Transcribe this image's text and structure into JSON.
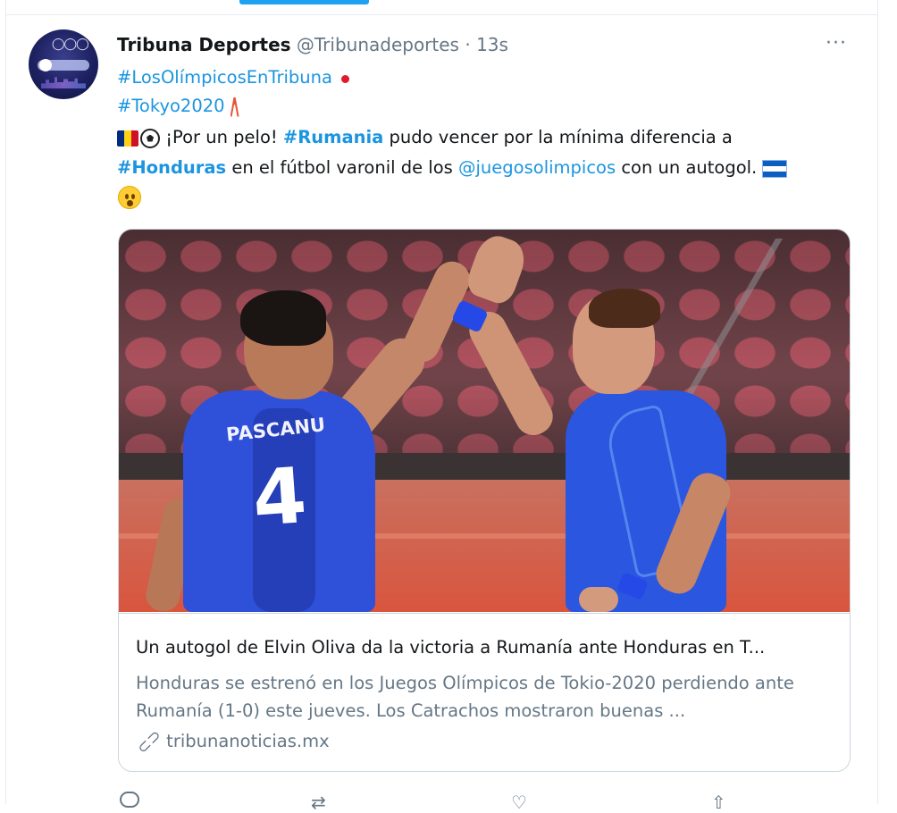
{
  "tweet": {
    "author_name": "Tribuna Deportes",
    "author_handle": "@Tribunadeportes",
    "separator": "·",
    "timestamp": "13s",
    "more_label": "···",
    "hashtag_1": "#LosOlímpicosEnTribuna",
    "hashtag_2": "#Tokyo2020",
    "line3_text_a": "¡Por un pelo! ",
    "hashtag_rumania": "#Rumania",
    "line3_text_b": " pudo vencer por la mínima diferencia a",
    "hashtag_honduras": "#Honduras",
    "line4_text_a": " en el fútbol varonil de los ",
    "mention": "@juegosolimpicos",
    "line4_text_b": " con un autogol."
  },
  "card": {
    "title": "Un autogol de Elvin Oliva da la victoria a Rumanía ante Honduras en T...",
    "description": "Honduras se estrenó en los Juegos Olímpicos de Tokio-2020 perdiendo ante Rumanía (1-0) este jueves. Los Catrachos mostraron buenas ...",
    "domain": "tribunanoticias.mx",
    "image": {
      "player_name": "PASCANU",
      "player_number": "4"
    }
  },
  "icons": {
    "avatar": "olympic-avatar",
    "more": "more-icon",
    "link": "link-icon",
    "reply": "reply-icon",
    "retweet": "retweet-icon",
    "like": "heart-icon",
    "share": "share-icon"
  },
  "colors": {
    "link_blue": "#1b95e0",
    "secondary_text": "#657786",
    "border": "#ccd6dd",
    "tab_indicator": "#1da1f2"
  }
}
